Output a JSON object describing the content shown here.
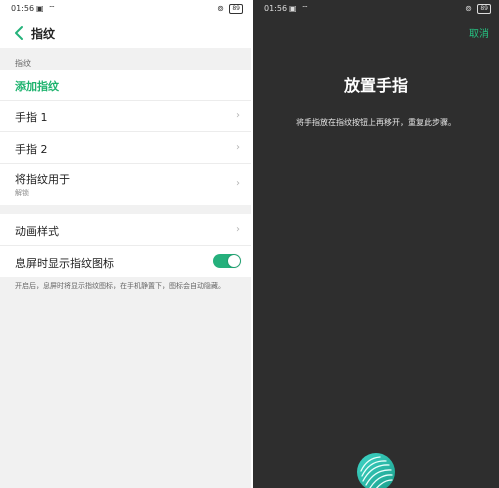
{
  "left": {
    "status": {
      "time": "01:56",
      "icons": "▣ ⌔",
      "right_icons": "⊚",
      "battery": "89"
    },
    "title": "指纹",
    "section_header": "指纹",
    "add_fingerprint": "添加指纹",
    "fingers": [
      {
        "label": "手指 1"
      },
      {
        "label": "手指 2"
      }
    ],
    "use_for": {
      "label": "将指纹用于",
      "sub": "解锁"
    },
    "animation_style": "动画样式",
    "show_icon_label": "息屏时显示指纹图标",
    "show_icon_enabled": true,
    "note": "开启后，息屏时将显示指纹图标，在手机静置下，图标会自动隐藏。",
    "accent_color": "#1eb36e"
  },
  "right": {
    "status": {
      "time": "01:56",
      "icons": "▣ ⌔",
      "right_icons": "⊚",
      "battery": "89"
    },
    "cancel": "取消",
    "heading": "放置手指",
    "instruction": "将手指放在指纹按钮上再移开，重复此步骤。",
    "background_color": "#2e2e2e",
    "icon": "fingerprint-icon"
  }
}
